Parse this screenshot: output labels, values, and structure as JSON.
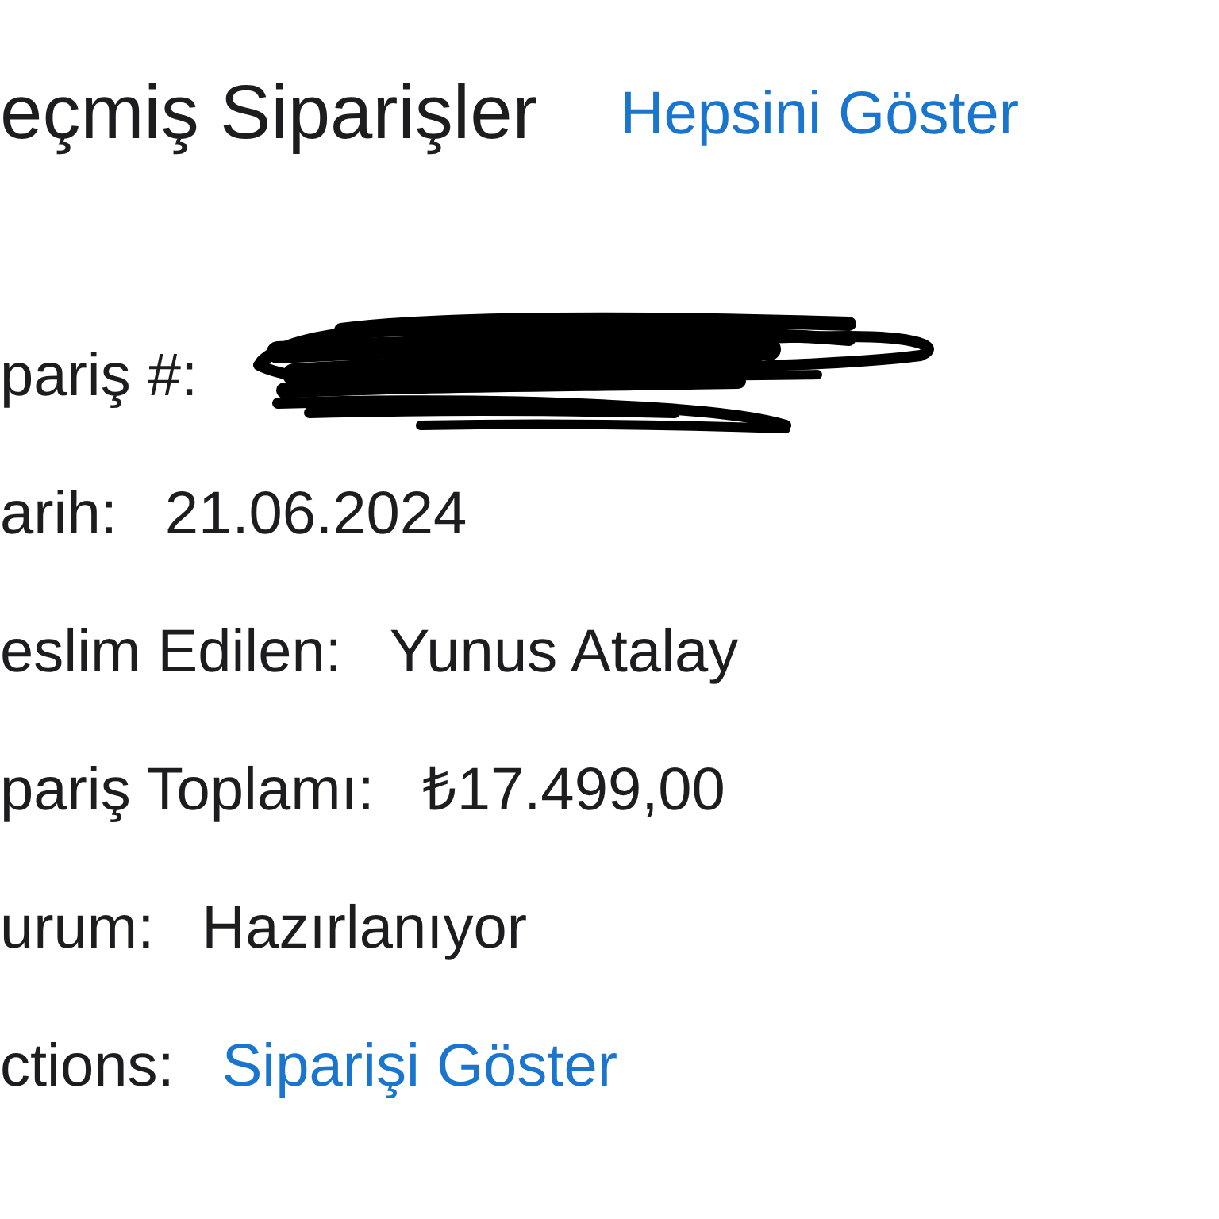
{
  "header": {
    "title": "eçmiş Siparişler",
    "link": "Hepsini Göster"
  },
  "fields": [
    {
      "kind": "redacted",
      "label": "pariş #:"
    },
    {
      "kind": "text",
      "label": "arih:",
      "value": "21.06.2024"
    },
    {
      "kind": "text",
      "label": "eslim Edilen:",
      "value": "Yunus Atalay"
    },
    {
      "kind": "text",
      "label": "pariş Toplamı:",
      "value": "₺17.499,00"
    },
    {
      "kind": "text",
      "label": "urum:",
      "value": "Hazırlanıyor"
    },
    {
      "kind": "link",
      "label": "ctions:",
      "value": "Siparişi Göster"
    }
  ]
}
